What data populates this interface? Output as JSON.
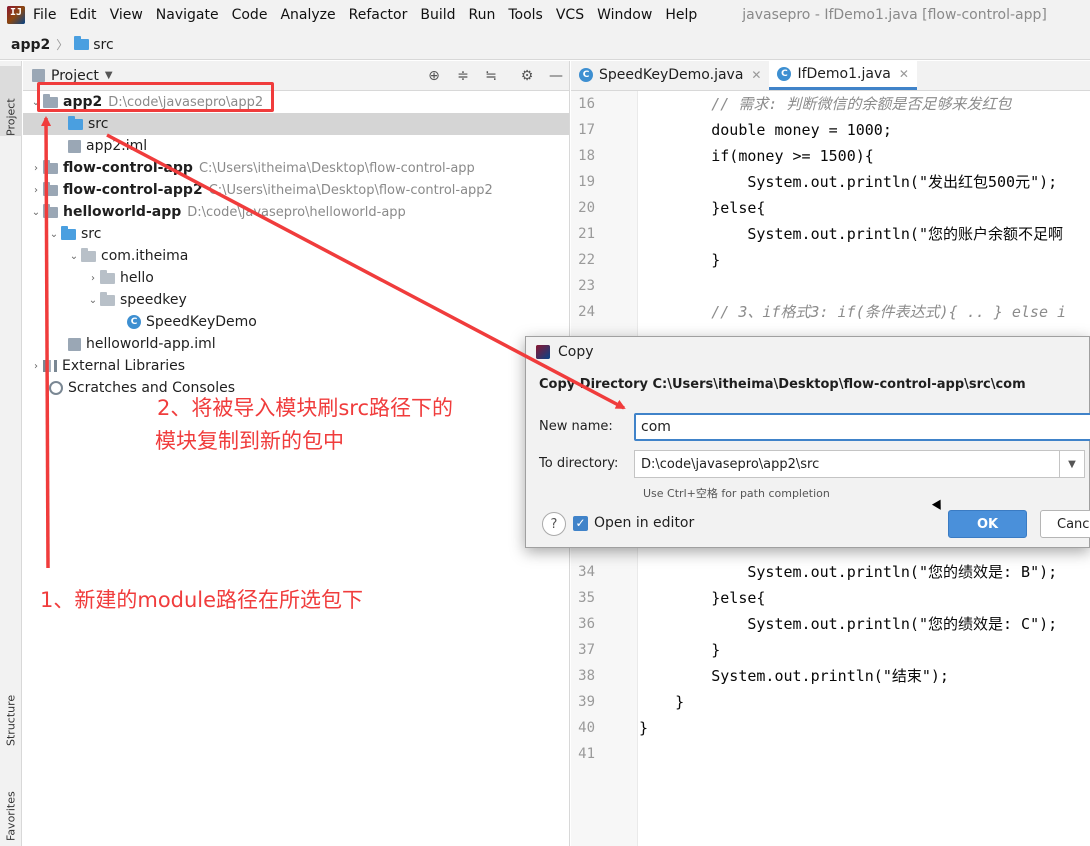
{
  "menubar": {
    "logo": "IJ",
    "items": [
      "File",
      "Edit",
      "View",
      "Navigate",
      "Code",
      "Analyze",
      "Refactor",
      "Build",
      "Run",
      "Tools",
      "VCS",
      "Window",
      "Help"
    ],
    "window_title": "javasepro - IfDemo1.java [flow-control-app]"
  },
  "navbar": {
    "project": "app2",
    "folder": "src"
  },
  "side_strip": {
    "project": "Project",
    "structure": "Structure",
    "favorites": "Favorites"
  },
  "project_panel": {
    "title": "Project",
    "tree": [
      {
        "label": "app2",
        "path": "D:\\code\\javasepro\\app2",
        "bold": true,
        "expanded": true
      },
      {
        "label": "src",
        "selected": true
      },
      {
        "label": "app2.iml"
      },
      {
        "label": "flow-control-app",
        "path": "C:\\Users\\itheima\\Desktop\\flow-control-app",
        "bold": true
      },
      {
        "label": "flow-control-app2",
        "path": "C:\\Users\\itheima\\Desktop\\flow-control-app2",
        "bold": true
      },
      {
        "label": "helloworld-app",
        "path": "D:\\code\\javasepro\\helloworld-app",
        "bold": true,
        "expanded": true
      },
      {
        "label": "src"
      },
      {
        "label": "com.itheima"
      },
      {
        "label": "hello"
      },
      {
        "label": "speedkey"
      },
      {
        "label": "SpeedKeyDemo"
      },
      {
        "label": "helloworld-app.iml"
      },
      {
        "label": "External Libraries"
      },
      {
        "label": "Scratches and Consoles"
      }
    ]
  },
  "editor": {
    "tabs": [
      {
        "label": "SpeedKeyDemo.java",
        "active": false
      },
      {
        "label": "IfDemo1.java",
        "active": true
      }
    ],
    "lines": [
      {
        "no": "16",
        "text": "        // 需求: 判断微信的余额是否足够来发红包"
      },
      {
        "no": "17",
        "text": "        double money = 1000;"
      },
      {
        "no": "18",
        "text": "        if(money >= 1500){"
      },
      {
        "no": "19",
        "text": "            System.out.println(\"发出红包500元\");"
      },
      {
        "no": "20",
        "text": "        }else{"
      },
      {
        "no": "21",
        "text": "            System.out.println(\"您的账户余额不足啊"
      },
      {
        "no": "22",
        "text": "        }"
      },
      {
        "no": "23",
        "text": ""
      },
      {
        "no": "24",
        "text": "        // 3、if格式3: if(条件表达式){ .. } else i"
      },
      {
        "no": "34",
        "text": "            System.out.println(\"您的绩效是: B\");"
      },
      {
        "no": "35",
        "text": "        }else{"
      },
      {
        "no": "36",
        "text": "            System.out.println(\"您的绩效是: C\");"
      },
      {
        "no": "37",
        "text": "        }"
      },
      {
        "no": "38",
        "text": "        System.out.println(\"结束\");"
      },
      {
        "no": "39",
        "text": "    }"
      },
      {
        "no": "40",
        "text": "}"
      },
      {
        "no": "41",
        "text": ""
      }
    ]
  },
  "copy_dialog": {
    "title": "Copy",
    "heading": "Copy Directory C:\\Users\\itheima\\Desktop\\flow-control-app\\src\\com",
    "new_name_label": "New name:",
    "new_name_value": "com",
    "to_directory_label": "To directory:",
    "to_directory_value": "D:\\code\\javasepro\\app2\\src",
    "hint": "Use Ctrl+空格 for path completion",
    "open_in_editor_label": "Open in editor",
    "open_in_editor_checked": true,
    "ok_label": "OK",
    "cancel_label": "Cance"
  },
  "annotations": {
    "step1": "1、新建的module路径在所选包下",
    "step2_line1": "2、将被导入模块刷src路径下的",
    "step2_line2": "模块复制到新的包中",
    "color": "#f03c3c"
  }
}
